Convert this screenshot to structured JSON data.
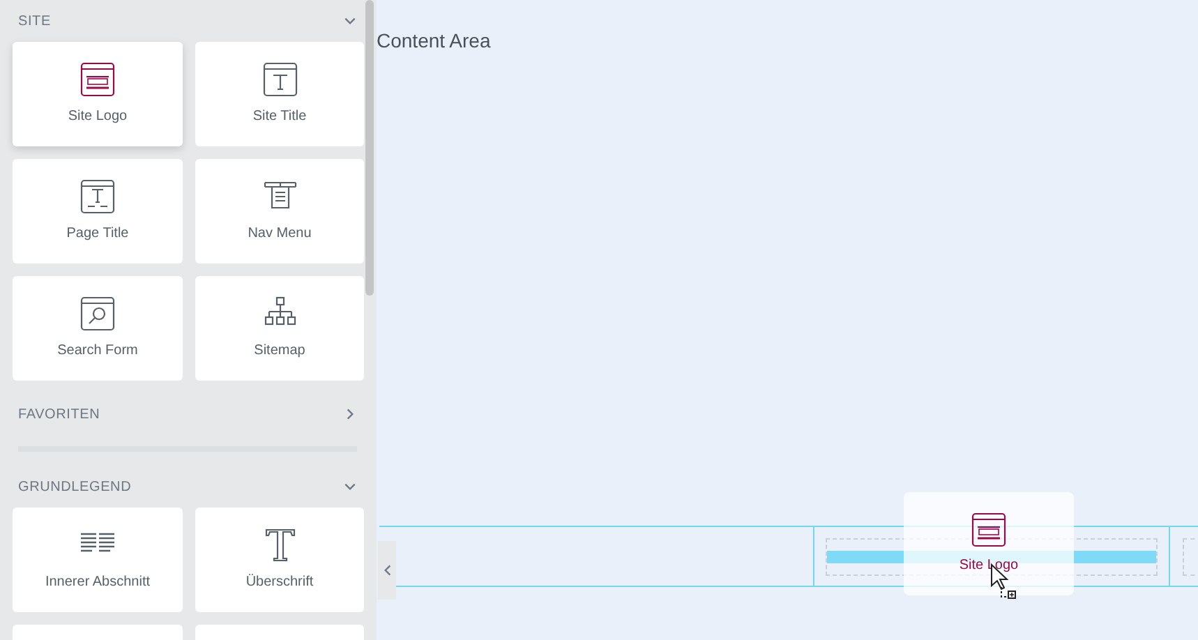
{
  "sidebar": {
    "sections": [
      {
        "title": "SITE",
        "expanded": true,
        "widgets": [
          {
            "label": "Site Logo",
            "kind": "logo",
            "selected": true
          },
          {
            "label": "Site Title",
            "kind": "title",
            "selected": false
          },
          {
            "label": "Page Title",
            "kind": "pagetitle",
            "selected": false
          },
          {
            "label": "Nav Menu",
            "kind": "navmenu",
            "selected": false
          },
          {
            "label": "Search Form",
            "kind": "search",
            "selected": false
          },
          {
            "label": "Sitemap",
            "kind": "sitemap",
            "selected": false
          }
        ]
      },
      {
        "title": "FAVORITEN",
        "expanded": false
      },
      {
        "title": "GRUNDLEGEND",
        "expanded": true,
        "widgets": [
          {
            "label": "Innerer Abschnitt",
            "kind": "inner",
            "selected": false
          },
          {
            "label": "Überschrift",
            "kind": "heading",
            "selected": false
          }
        ]
      }
    ]
  },
  "canvas": {
    "heading": "Content Area",
    "drag_ghost": {
      "label": "Site Logo",
      "kind": "logo"
    }
  }
}
